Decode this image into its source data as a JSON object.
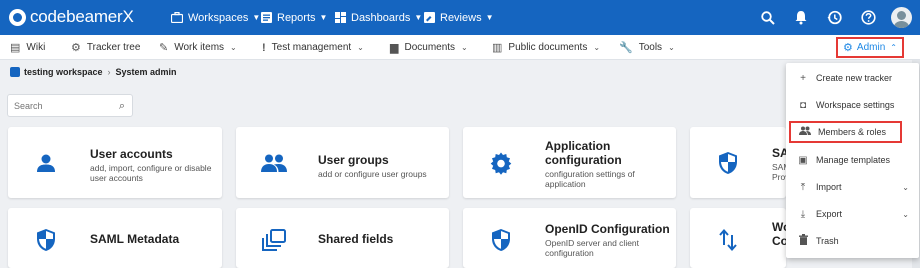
{
  "app": {
    "name": "codebeamerX"
  },
  "topnav": {
    "items": [
      {
        "label": "Workspaces",
        "icon": "briefcase-icon"
      },
      {
        "label": "Reports",
        "icon": "report-icon"
      },
      {
        "label": "Dashboards",
        "icon": "dashboard-icon"
      },
      {
        "label": "Reviews",
        "icon": "review-icon"
      }
    ],
    "right_icons": [
      "search-icon",
      "bell-icon",
      "history-icon",
      "help-icon",
      "avatar"
    ]
  },
  "subnav": {
    "items": [
      {
        "label": "Wiki",
        "icon": "wiki-icon"
      },
      {
        "label": "Tracker tree",
        "icon": "tracker-tree-icon"
      },
      {
        "label": "Work items",
        "icon": "work-items-icon"
      },
      {
        "label": "Test management",
        "icon": "test-icon"
      },
      {
        "label": "Documents",
        "icon": "document-icon"
      },
      {
        "label": "Public documents",
        "icon": "public-doc-icon"
      },
      {
        "label": "Tools",
        "icon": "wrench-icon"
      }
    ],
    "admin_label": "Admin"
  },
  "breadcrumb": {
    "workspace": "testing workspace",
    "page": "System admin"
  },
  "search": {
    "placeholder": "Search"
  },
  "cards": [
    {
      "title": "User accounts",
      "desc": "add, import, configure or disable user accounts",
      "icon": "person-icon"
    },
    {
      "title": "User groups",
      "desc": "add or configure user groups",
      "icon": "group-icon"
    },
    {
      "title": "Application configuration",
      "desc": "configuration settings of application",
      "icon": "gear-icon"
    },
    {
      "title": "SA",
      "desc": "SAM Prov",
      "icon": "shield-icon"
    },
    {
      "title": "SAML Metadata",
      "desc": "",
      "icon": "shield-icon"
    },
    {
      "title": "Shared fields",
      "desc": "",
      "icon": "shared-fields-icon"
    },
    {
      "title": "OpenID Configuration",
      "desc": "OpenID server and client configuration",
      "icon": "shield-icon"
    },
    {
      "title": "Wo Co",
      "desc": "",
      "icon": "sort-arrows-icon"
    }
  ],
  "admin_menu": {
    "items": [
      {
        "label": "Create new tracker",
        "icon": "plus-icon"
      },
      {
        "label": "Workspace settings",
        "icon": "settings-box-icon"
      },
      {
        "label": "Members & roles",
        "icon": "members-icon"
      },
      {
        "label": "Manage templates",
        "icon": "template-icon"
      },
      {
        "label": "Import",
        "icon": "import-icon"
      },
      {
        "label": "Export",
        "icon": "export-icon"
      },
      {
        "label": "Trash",
        "icon": "trash-icon"
      }
    ]
  },
  "colors": {
    "brand": "#1565c0",
    "highlight": "#e53935",
    "admin_text": "#1e88e5"
  }
}
